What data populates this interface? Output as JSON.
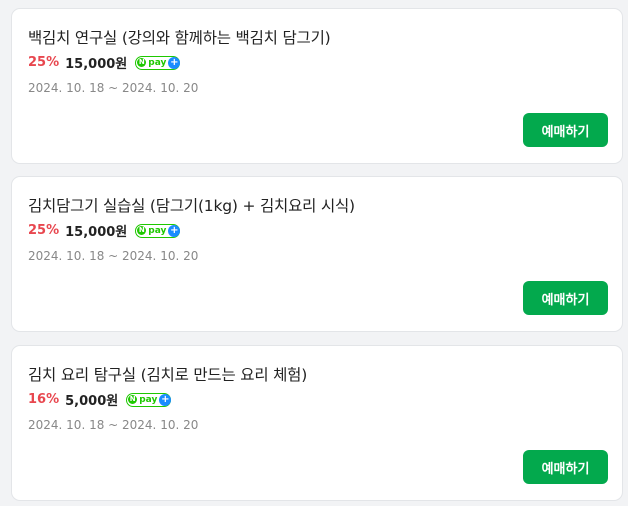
{
  "colors": {
    "discount": "#e8474f",
    "button": "#03a94d",
    "npay_green": "#1ec800",
    "npay_plus": "#1a8cff"
  },
  "products": [
    {
      "title": "백김치 연구실 (강의와 함께하는 백김치 담그기)",
      "discount": "25%",
      "price": "15,000원",
      "npay_label": "pay",
      "npay_plus": "+",
      "period": "2024. 10. 18 ~ 2024. 10. 20",
      "button_label": "예매하기"
    },
    {
      "title": "김치담그기 실습실 (담그기(1kg) + 김치요리 시식)",
      "discount": "25%",
      "price": "15,000원",
      "npay_label": "pay",
      "npay_plus": "+",
      "period": "2024. 10. 18 ~ 2024. 10. 20",
      "button_label": "예매하기"
    },
    {
      "title": "김치 요리 탐구실 (김치로 만드는 요리 체험)",
      "discount": "16%",
      "price": "5,000원",
      "npay_label": "pay",
      "npay_plus": "+",
      "period": "2024. 10. 18 ~ 2024. 10. 20",
      "button_label": "예매하기"
    }
  ]
}
